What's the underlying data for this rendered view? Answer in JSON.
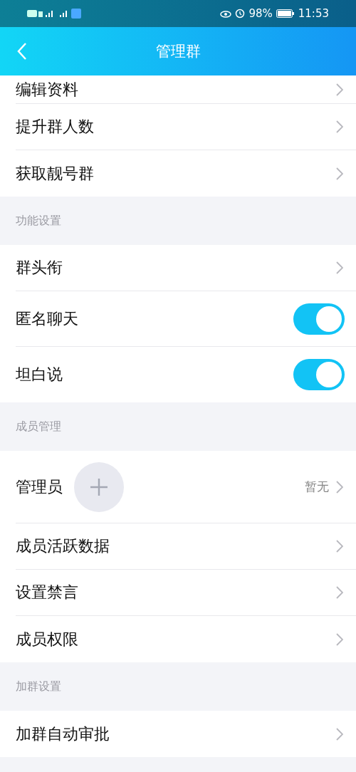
{
  "status_bar": {
    "battery": "98%",
    "time": "11:53"
  },
  "nav": {
    "title": "管理群"
  },
  "sections": [
    {
      "items": [
        {
          "kind": "link",
          "label": "编辑资料"
        },
        {
          "kind": "link",
          "label": "提升群人数"
        },
        {
          "kind": "link",
          "label": "获取靓号群"
        }
      ]
    },
    {
      "title": "功能设置",
      "items": [
        {
          "kind": "link",
          "label": "群头衔"
        },
        {
          "kind": "toggle",
          "label": "匿名聊天",
          "on": true
        },
        {
          "kind": "toggle",
          "label": "坦白说",
          "on": true
        }
      ]
    },
    {
      "title": "成员管理",
      "items": [
        {
          "kind": "admin",
          "label": "管理员",
          "value": "暂无"
        },
        {
          "kind": "link",
          "label": "成员活跃数据"
        },
        {
          "kind": "link",
          "label": "设置禁言"
        },
        {
          "kind": "link",
          "label": "成员权限"
        }
      ]
    },
    {
      "title": "加群设置",
      "items": [
        {
          "kind": "link",
          "label": "加群自动审批"
        }
      ]
    }
  ]
}
